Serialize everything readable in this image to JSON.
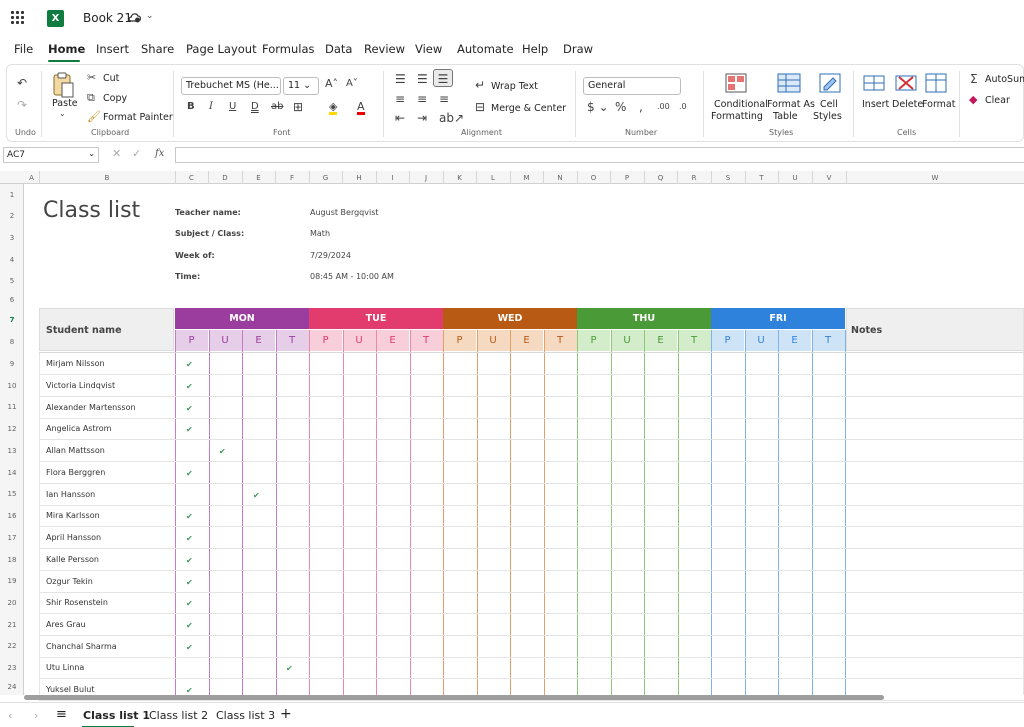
{
  "app": {
    "title": "Book 21"
  },
  "menu": [
    "File",
    "Home",
    "Insert",
    "Share",
    "Page Layout",
    "Formulas",
    "Data",
    "Review",
    "View",
    "Automate",
    "Help",
    "Draw"
  ],
  "ribbon": {
    "undo_label": "Undo",
    "clipboard": {
      "paste": "Paste",
      "cut": "Cut",
      "copy": "Copy",
      "format_painter": "Format Painter",
      "label": "Clipboard"
    },
    "font": {
      "name": "Trebuchet MS (He...",
      "size": "11",
      "label": "Font"
    },
    "alignment": {
      "wrap": "Wrap Text",
      "merge": "Merge & Center",
      "label": "Alignment"
    },
    "number": {
      "format": "General",
      "label": "Number"
    },
    "styles": {
      "conditional": "Conditional",
      "formatting": "Formatting",
      "format_as": "Format As",
      "table": "Table",
      "cell": "Cell",
      "cell_styles": "Styles",
      "label": "Styles"
    },
    "cells": {
      "insert": "Insert",
      "delete": "Delete",
      "format": "Format",
      "label": "Cells"
    },
    "editing": {
      "autosum": "AutoSum",
      "clear": "Clear"
    }
  },
  "formula_bar": {
    "name_box": "AC7",
    "fx": "fx"
  },
  "columns": [
    "A",
    "B",
    "C",
    "D",
    "E",
    "F",
    "G",
    "H",
    "I",
    "J",
    "K",
    "L",
    "M",
    "N",
    "O",
    "P",
    "Q",
    "R",
    "S",
    "T",
    "U",
    "V",
    "W"
  ],
  "rows": [
    "1",
    "2",
    "3",
    "4",
    "5",
    "6",
    "7",
    "8",
    "9",
    "10",
    "11",
    "12",
    "13",
    "14",
    "15",
    "16",
    "17",
    "18",
    "19",
    "20",
    "21",
    "22",
    "23",
    "24"
  ],
  "sheet": {
    "title": "Class list",
    "info_labels": [
      "Teacher name:",
      "Subject / Class:",
      "Week of:",
      "Time:"
    ],
    "info_values": [
      "August Bergqvist",
      "Math",
      "7/29/2024",
      "08:45 AM - 10:00 AM"
    ],
    "student_header": "Student name",
    "notes_header": "Notes",
    "days": [
      {
        "name": "MON",
        "color": "#9b3d9e",
        "light": "#e6cde8",
        "line": "#c47ac8"
      },
      {
        "name": "TUE",
        "color": "#e23b6d",
        "light": "#f8cedb",
        "line": "#ec8aa6"
      },
      {
        "name": "WED",
        "color": "#b85a14",
        "light": "#f5d9c1",
        "line": "#e3a06c"
      },
      {
        "name": "THU",
        "color": "#4b9a38",
        "light": "#d3ecc9",
        "line": "#8cc77a"
      },
      {
        "name": "FRI",
        "color": "#2f82dc",
        "light": "#cfe3f7",
        "line": "#7fb2ea"
      }
    ],
    "sub": [
      "P",
      "U",
      "E",
      "T"
    ],
    "students": [
      "Mirjam Nilsson",
      "Victoria Lindqvist",
      "Alexander Martensson",
      "Angelica Astrom",
      "Allan Mattsson",
      "Flora Berggren",
      "Ian Hansson",
      "Mira Karlsson",
      "April Hansson",
      "Kalle Persson",
      "Ozgur Tekin",
      "Shir Rosenstein",
      "Ares Grau",
      "Chanchal Sharma",
      "Utu Linna",
      "Yuksel Bulut"
    ],
    "mon_checks": [
      0,
      0,
      0,
      0,
      1,
      0,
      2,
      0,
      0,
      0,
      0,
      0,
      0,
      0,
      3,
      0
    ]
  },
  "tabs": [
    "Class list 1",
    "Class list 2",
    "Class list 3"
  ]
}
